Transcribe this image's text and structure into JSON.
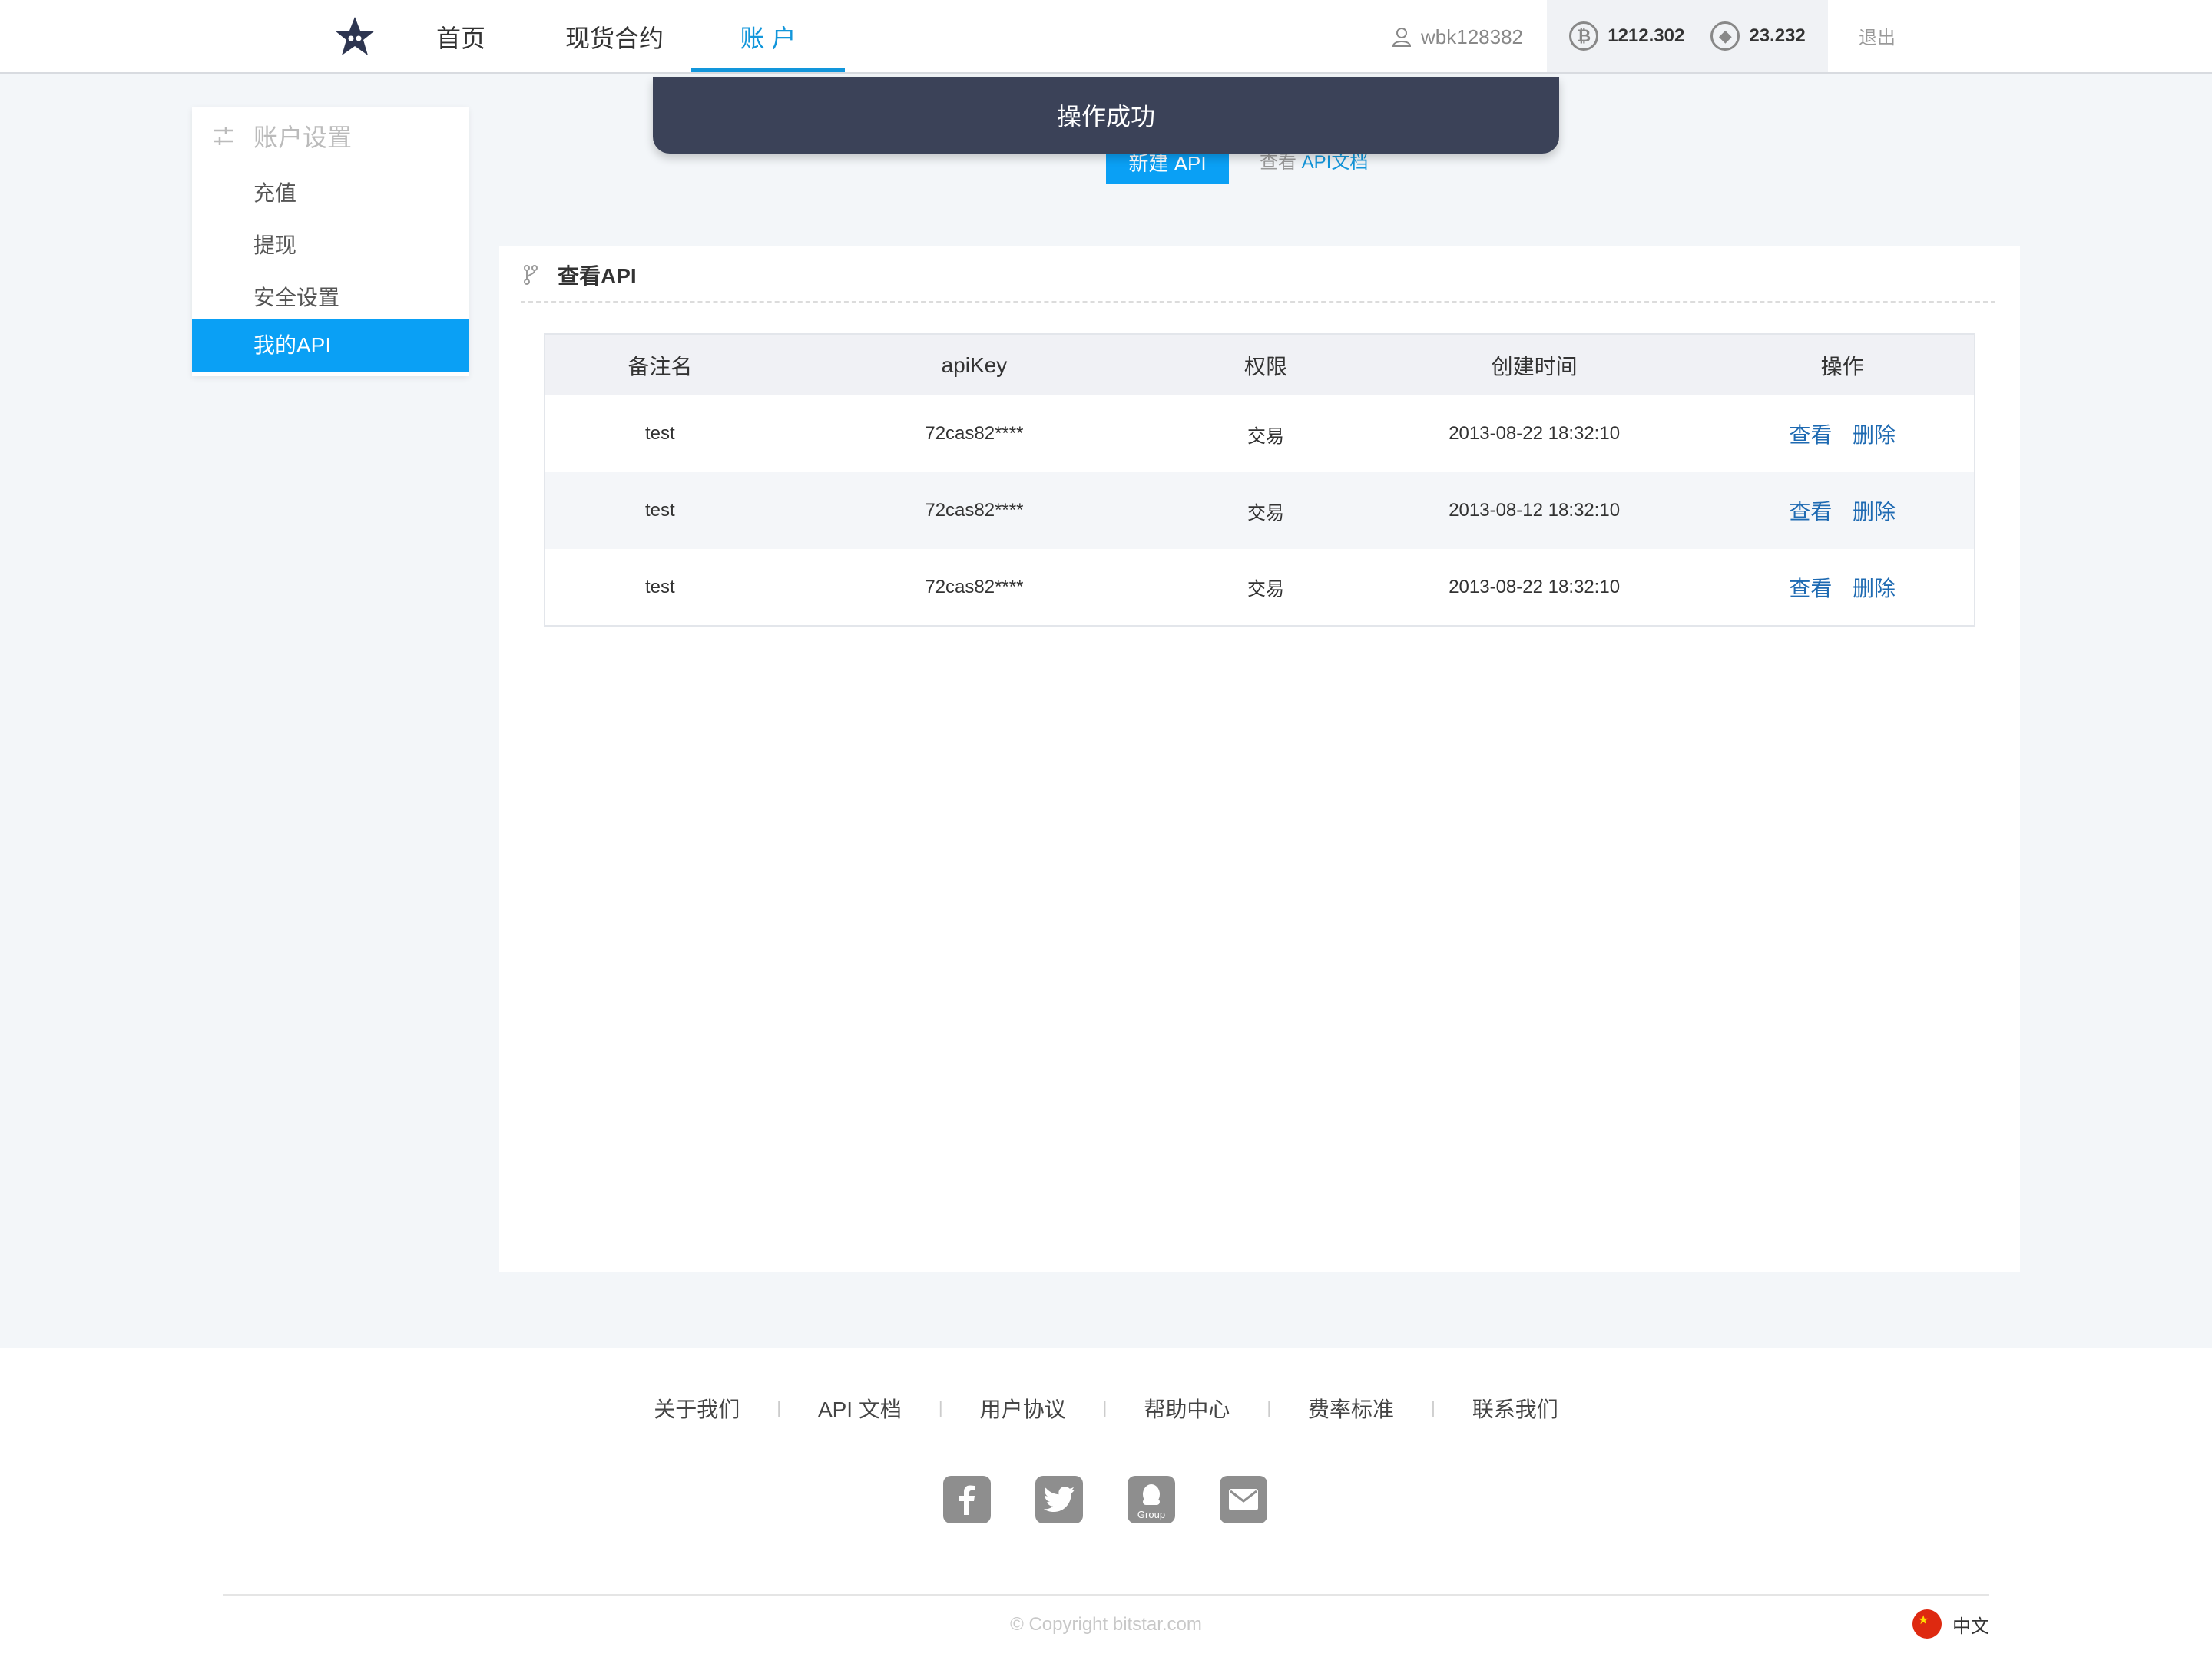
{
  "header": {
    "nav": [
      "首页",
      "现货合约",
      "账 户"
    ],
    "active_nav": "账 户",
    "username": "wbk128382",
    "balances": [
      {
        "coin": "btc",
        "icon": "bitcoin-icon",
        "value": "1212.302"
      },
      {
        "coin": "eth",
        "icon": "ethereum-icon",
        "value": "23.232"
      }
    ],
    "logout_label": "退出"
  },
  "toast": {
    "message": "操作成功"
  },
  "sidebar": {
    "header": "账户设置",
    "items": [
      {
        "label": "充值",
        "active": false
      },
      {
        "label": "提现",
        "active": false
      },
      {
        "label": "安全设置",
        "active": false
      },
      {
        "label": "我的API",
        "active": true
      }
    ]
  },
  "actions": {
    "new_api_label": "新建 API",
    "view_prefix": "查看",
    "doc_link": "API文档"
  },
  "panel": {
    "title": "查看API",
    "columns": [
      "备注名",
      "apiKey",
      "权限",
      "创建时间",
      "操作"
    ],
    "rows": [
      {
        "name": "test",
        "apikey": "72cas82****",
        "permission": "交易",
        "created": "2013-08-22 18:32:10",
        "view": "查看",
        "delete": "删除"
      },
      {
        "name": "test",
        "apikey": "72cas82****",
        "permission": "交易",
        "created": "2013-08-12 18:32:10",
        "view": "查看",
        "delete": "删除"
      },
      {
        "name": "test",
        "apikey": "72cas82****",
        "permission": "交易",
        "created": "2013-08-22 18:32:10",
        "view": "查看",
        "delete": "删除"
      }
    ]
  },
  "footer": {
    "links": [
      "关于我们",
      "API 文档",
      "用户协议",
      "帮助中心",
      "费率标准",
      "联系我们"
    ],
    "socials": [
      {
        "icon": "facebook-icon"
      },
      {
        "icon": "twitter-icon"
      },
      {
        "icon": "qq-group-icon",
        "caption": "Group"
      },
      {
        "icon": "mail-icon"
      }
    ],
    "copyright": "© Copyright    bitstar.com",
    "language": "中文"
  },
  "colors": {
    "accent": "#0aa0f5",
    "nav_active": "#1296db",
    "toast_bg": "#3b4258",
    "link": "#1e6ab2"
  }
}
